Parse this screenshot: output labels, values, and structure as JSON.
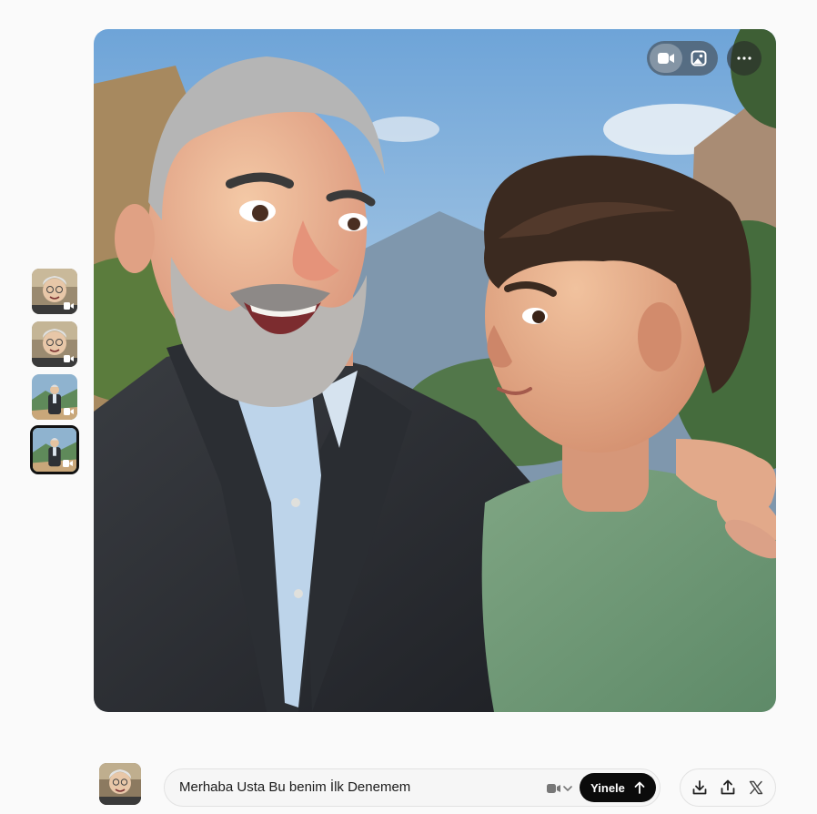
{
  "thumbnails": [
    {
      "name": "thumb-1",
      "kind": "video",
      "selected": false
    },
    {
      "name": "thumb-2",
      "kind": "video",
      "selected": false
    },
    {
      "name": "thumb-3",
      "kind": "video",
      "selected": false
    },
    {
      "name": "thumb-4",
      "kind": "video",
      "selected": true
    }
  ],
  "viewer": {
    "toggle_options": [
      "video-icon",
      "image-icon"
    ],
    "active_toggle": "video-icon",
    "more_icon": "more-horizontal-icon"
  },
  "prompt": {
    "text": "Merhaba Usta Bu benim İlk Denemem",
    "mode_icon": "video-icon",
    "regenerate_label": "Yinele"
  },
  "actions": [
    "download-icon",
    "share-icon",
    "x-logo-icon"
  ],
  "colors": {
    "regenerate_bg": "#0b0b0b",
    "page_bg": "#fafafa"
  }
}
